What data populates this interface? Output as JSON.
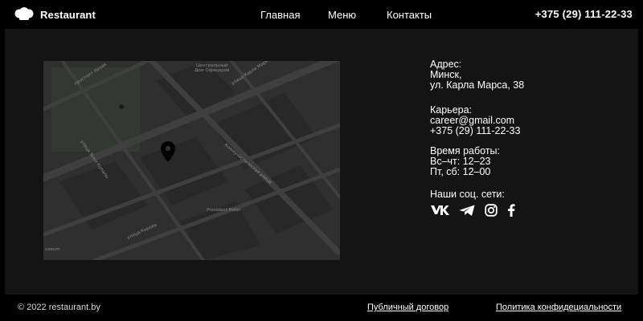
{
  "header": {
    "logo_text": "Restaurant",
    "nav": [
      "Главная",
      "Меню",
      "Контакты"
    ],
    "phone": "+375 (29) 111-22-33"
  },
  "map": {
    "labels": {
      "street_top_left": "проспект Незав.",
      "house_officers_1": "Центральный",
      "house_officers_2": "Дом Офицеров",
      "street_karla_marksa": "улица Карла Маркса",
      "street_left": "улица Янки Купалы",
      "street_kommunisticheskaya": "Коммунистическая улица",
      "hotel": "President Hotel",
      "street_kirova": "улица Кирова",
      "museum": "useum"
    }
  },
  "contacts": {
    "address_title": "Адрес:",
    "address_city": "Минск,",
    "address_street": "ул. Карла Марса, 38",
    "career_title": "Карьера:",
    "career_email": "career@gmail.com",
    "career_phone": "+375 (29) 111-22-33",
    "hours_title": "Время работы:",
    "hours_weekdays": "Вс–чт: 12–23",
    "hours_weekend": "Пт, сб: 12–00",
    "social_title": "Наши соц. сети:",
    "social_icons": [
      "vk-icon",
      "telegram-icon",
      "instagram-icon",
      "facebook-icon"
    ]
  },
  "footer": {
    "copyright": "© 2022 restaurant.by",
    "offer_link": "Публичный договор",
    "privacy_link": "Политика конфидециальности"
  },
  "colors": {
    "background": "#000000",
    "panel": "#141414",
    "map_base": "#2f2f2f",
    "text": "#ffffff"
  }
}
